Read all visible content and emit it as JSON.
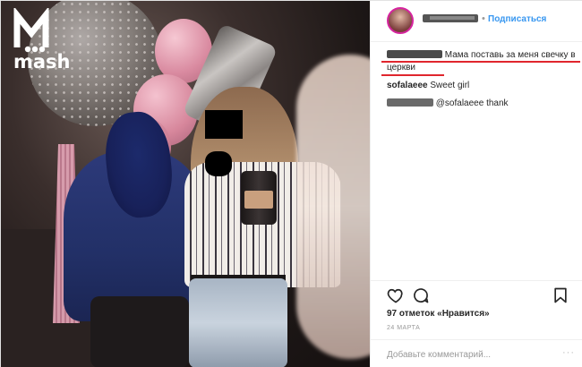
{
  "photo": {
    "watermark_text": "mash"
  },
  "post": {
    "follow_label": "Подписаться",
    "separator": "•",
    "comments": [
      {
        "user_visible": "",
        "text": "Мама поставь за меня свечку в церкви"
      },
      {
        "user": "sofalaeee",
        "text": "Sweet girl"
      },
      {
        "user_visible": "",
        "text": "@sofalaeee thank"
      }
    ],
    "likes_label": "97 отметок «Нравится»",
    "date_label": "24 МАРТА",
    "add_comment_placeholder": "Добавьте комментарий...",
    "more_dots": "···"
  },
  "icons": {
    "like": "heart-icon",
    "comment": "comment-bubble-icon",
    "save": "bookmark-icon",
    "brand": "mash-logo-icon"
  },
  "colors": {
    "accent": "#3897f0",
    "highlight": "#e0262d",
    "text": "#262626",
    "muted": "#999999"
  }
}
